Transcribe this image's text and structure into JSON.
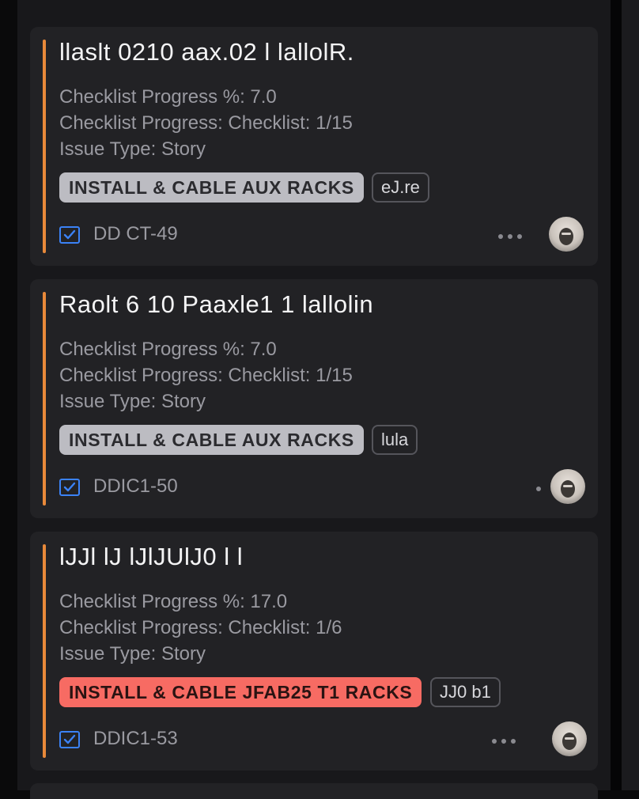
{
  "cards": [
    {
      "title": "llaslt 0210 aax.02 l lallolR.",
      "fields": [
        "Checklist Progress %: 7.0",
        "Checklist Progress: Checklist: 1/15",
        "Issue Type: Story"
      ],
      "label": "INSTALL & CABLE AUX RACKS",
      "label_color": "#bcbcc2",
      "tag": "eJ.re",
      "issue_key": "DD CT-49",
      "icon": "checkbox-icon"
    },
    {
      "title": "Raolt 6 10 Paaxle1 1 lallolin",
      "fields": [
        "Checklist Progress %: 7.0",
        "Checklist Progress: Checklist: 1/15",
        "Issue Type: Story"
      ],
      "label": "INSTALL & CABLE AUX RACKS",
      "label_color": "#bcbcc2",
      "tag": "lula",
      "issue_key": "DDIC1-50",
      "icon": "checkbox-icon"
    },
    {
      "title": "lJJl lJ lJlJUlJ0 l l",
      "fields": [
        "Checklist Progress %: 17.0",
        "Checklist Progress: Checklist: 1/6",
        "Issue Type: Story"
      ],
      "label": "INSTALL & CABLE JFAB25 T1 RACKS",
      "label_color": "#f76b63",
      "tag": "JJ0 b1",
      "issue_key": "DDIC1-53",
      "icon": "checkbox-icon"
    }
  ],
  "colors": {
    "accent_bar": "#e8893a",
    "checkbox": "#3b82f6",
    "card_bg": "#222225",
    "page_bg": "#18181b"
  }
}
